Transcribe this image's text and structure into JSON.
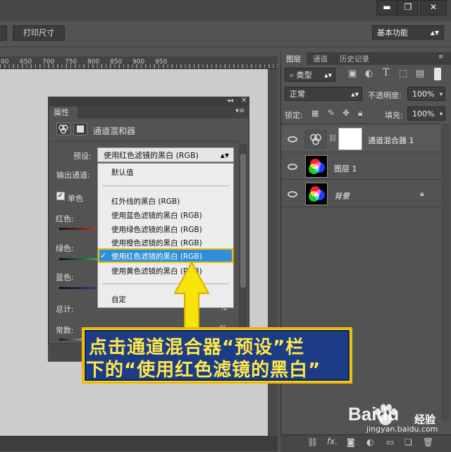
{
  "options_bar": {
    "print_size_label": "打印尺寸",
    "workspace_label": "基本功能"
  },
  "ruler": {
    "labels": [
      "00",
      "650",
      "700",
      "750",
      "800",
      "850",
      "900",
      "950"
    ]
  },
  "properties_panel": {
    "tab_label": "属性",
    "adjustment_title": "通道混和器",
    "preset_label": "预设:",
    "preset_value": "使用红色滤镜的黑白 (RGB)",
    "output_channel_label": "输出通道:",
    "monochrome_label": "单色",
    "monochrome_checked": true,
    "red_label": "红色:",
    "green_label": "绿色:",
    "blue_label": "蓝色:",
    "total_label": "总计:",
    "constant_label": "常数:",
    "percent_symbol": "%"
  },
  "preset_dropdown": {
    "items": [
      "默认值",
      "红外线的黑白 (RGB)",
      "使用蓝色滤镜的黑白 (RGB)",
      "使用绿色滤镜的黑白 (RGB)",
      "使用橙色滤镜的黑白 (RGB)",
      "使用红色滤镜的黑白 (RGB)",
      "使用黄色滤镜的黑白 (RGB)",
      "自定"
    ],
    "selected_index": 5,
    "check_glyph": "✓"
  },
  "layers_panel": {
    "tabs": [
      "图层",
      "通道",
      "历史记录"
    ],
    "kind_label": "类型",
    "blend_mode": "正常",
    "opacity_label": "不透明度:",
    "opacity_value": "100%",
    "lock_label": "锁定:",
    "fill_label": "填充:",
    "fill_value": "100%",
    "layers": [
      {
        "name": "通道混合器 1",
        "type": "adjustment"
      },
      {
        "name": "图层 1",
        "type": "image"
      },
      {
        "name": "背景",
        "type": "background",
        "locked": true
      }
    ]
  },
  "annotation": {
    "line1": "点击通道混合器“预设”栏",
    "line2": "下的“使用红色滤镜的黑白”",
    "arrow_color": "#f5e50a",
    "box_color": "#1c3d86"
  },
  "watermark": {
    "brand": "Baidu",
    "cn": "经验",
    "url": "jingyan.baidu.com"
  }
}
